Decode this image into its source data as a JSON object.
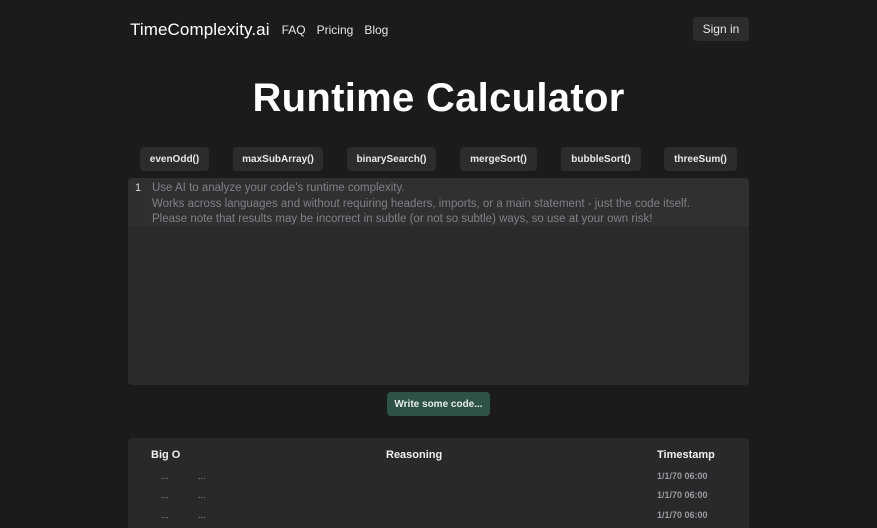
{
  "header": {
    "brand": "TimeComplexity.ai",
    "nav": [
      "FAQ",
      "Pricing",
      "Blog"
    ],
    "sign_in": "Sign in"
  },
  "main": {
    "title": "Runtime Calculator",
    "examples": [
      "evenOdd()",
      "maxSubArray()",
      "binarySearch()",
      "mergeSort()",
      "bubbleSort()",
      "threeSum()"
    ],
    "editor": {
      "line_number": "1",
      "placeholder_lines": [
        "Use AI to analyze your code's runtime complexity.",
        "Works across languages and without requiring headers, imports, or a main statement - just the code itself.",
        "Please note that results may be incorrect in subtle (or not so subtle) ways, so use at your own risk!"
      ]
    },
    "submit_label": "Write some code..."
  },
  "results": {
    "headers": {
      "big_o": "Big O",
      "reasoning": "Reasoning",
      "timestamp": "Timestamp"
    },
    "rows": [
      {
        "big_o": "...",
        "reasoning": "...",
        "timestamp": "1/1/70 06:00"
      },
      {
        "big_o": "...",
        "reasoning": "...",
        "timestamp": "1/1/70 06:00"
      },
      {
        "big_o": "...",
        "reasoning": "...",
        "timestamp": "1/1/70 06:00"
      }
    ]
  },
  "colors": {
    "background": "#1b1b1c",
    "button": "#2c2c2e",
    "editor": "#2a2a2c",
    "submit": "#2e5248"
  }
}
